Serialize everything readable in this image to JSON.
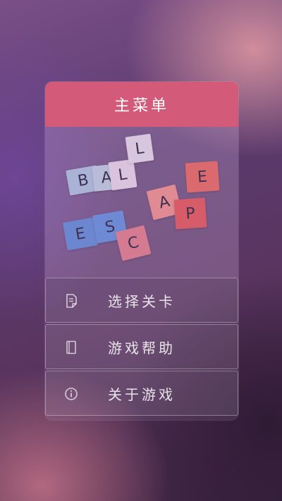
{
  "header": {
    "title": "主菜单"
  },
  "logo": {
    "tiles": [
      {
        "letter": "B",
        "color": "#aab3d6"
      },
      {
        "letter": "A",
        "color": "#b9bcd8"
      },
      {
        "letter": "L",
        "color": "#d9c3dd"
      },
      {
        "letter": "L",
        "color": "#d8c6de"
      },
      {
        "letter": "E",
        "color": "#6d86d0"
      },
      {
        "letter": "S",
        "color": "#6f8ad4"
      },
      {
        "letter": "C",
        "color": "#d47b92"
      },
      {
        "letter": "A",
        "color": "#e08a93"
      },
      {
        "letter": "P",
        "color": "#d65c6a"
      },
      {
        "letter": "E",
        "color": "#db6a6e"
      }
    ]
  },
  "menu": {
    "items": [
      {
        "label": "选择关卡",
        "icon": "document-icon"
      },
      {
        "label": "游戏帮助",
        "icon": "book-icon"
      },
      {
        "label": "关于游戏",
        "icon": "info-icon"
      }
    ]
  }
}
